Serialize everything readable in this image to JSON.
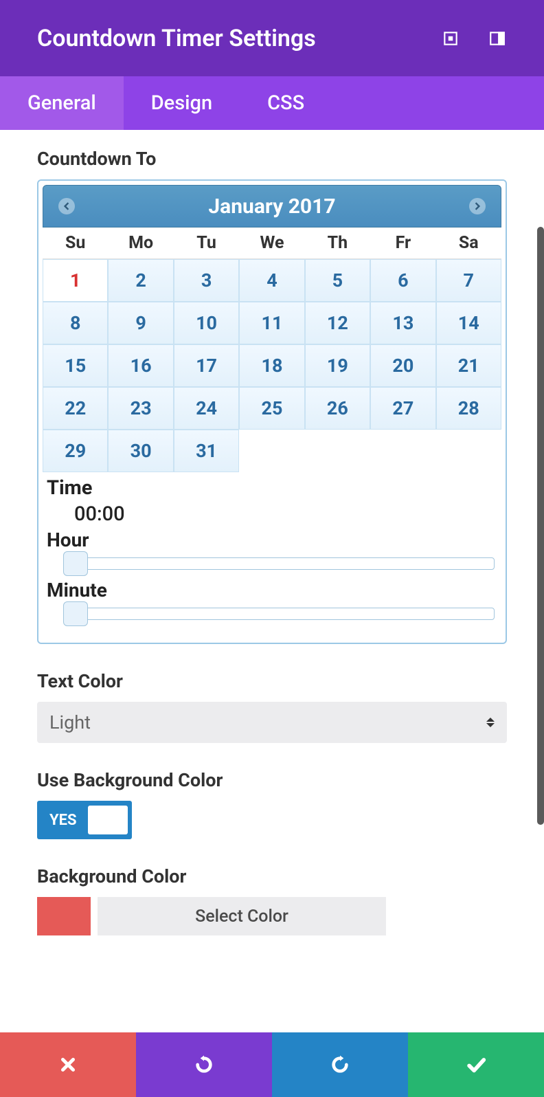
{
  "header": {
    "title": "Countdown Timer Settings"
  },
  "tabs": [
    {
      "label": "General",
      "active": true
    },
    {
      "label": "Design",
      "active": false
    },
    {
      "label": "CSS",
      "active": false
    }
  ],
  "countdown": {
    "label": "Countdown To",
    "month_year": "January 2017",
    "dayheads": [
      "Su",
      "Mo",
      "Tu",
      "We",
      "Th",
      "Fr",
      "Sa"
    ],
    "days": [
      1,
      2,
      3,
      4,
      5,
      6,
      7,
      8,
      9,
      10,
      11,
      12,
      13,
      14,
      15,
      16,
      17,
      18,
      19,
      20,
      21,
      22,
      23,
      24,
      25,
      26,
      27,
      28,
      29,
      30,
      31
    ],
    "selected_day": 1,
    "time_label": "Time",
    "time_value": "00:00",
    "hour_label": "Hour",
    "minute_label": "Minute"
  },
  "text_color": {
    "label": "Text Color",
    "value": "Light"
  },
  "use_bg": {
    "label": "Use Background Color",
    "toggle_label": "YES"
  },
  "bg_color": {
    "label": "Background Color",
    "button_label": "Select Color",
    "swatch": "#e55a57"
  }
}
